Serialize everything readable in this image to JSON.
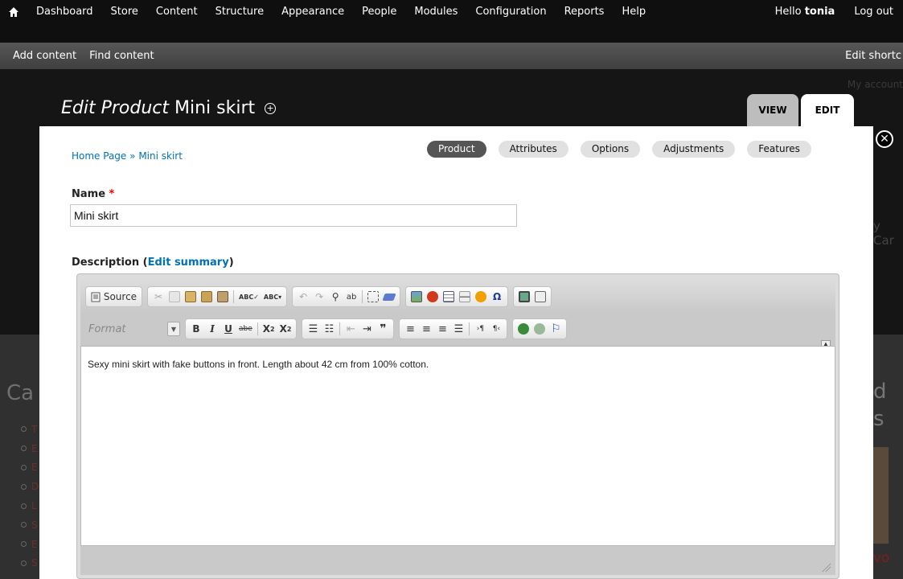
{
  "toolbar": {
    "menu": [
      "Dashboard",
      "Store",
      "Content",
      "Structure",
      "Appearance",
      "People",
      "Modules",
      "Configuration",
      "Reports",
      "Help"
    ],
    "hello_prefix": "Hello",
    "user": "tonia",
    "logout": "Log out"
  },
  "shortcuts": {
    "items": [
      "Add content",
      "Find content"
    ],
    "edit": "Edit shortc"
  },
  "background": {
    "my_account": "My account",
    "categories_heading": "Ca",
    "list_letters": [
      "T",
      "E",
      "E",
      "D",
      "L",
      "S",
      "E",
      "S"
    ],
    "right_d": "d",
    "right_s": "s",
    "cart_fragment": "y Car",
    "evo_fragment": "e vo"
  },
  "page": {
    "title_italic": "Edit Product",
    "title_name": "Mini skirt"
  },
  "tabs": {
    "view": "VIEW",
    "edit": "EDIT"
  },
  "overlay": {
    "breadcrumb": {
      "home": "Home Page",
      "sep": "»",
      "current": "Mini skirt"
    },
    "vertical_tabs": [
      "Product",
      "Attributes",
      "Options",
      "Adjustments",
      "Features"
    ],
    "active_tab": "Product",
    "name_label": "Name",
    "required_mark": "*",
    "name_value": "Mini skirt",
    "description_label": "Description",
    "edit_summary": "Edit summary",
    "format_placeholder": "Format",
    "source_label": "Source",
    "description_text": "Sexy mini skirt with fake buttons in front. Length about 42 cm from 100% cotton."
  },
  "colors": {
    "link": "#0071b3",
    "active_tab_bg": "#555555"
  }
}
